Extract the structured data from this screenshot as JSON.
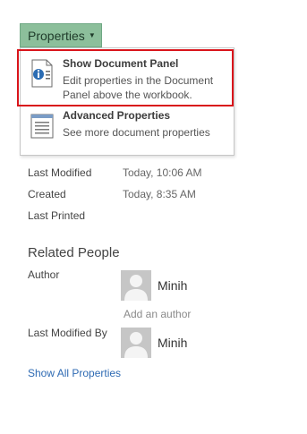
{
  "properties_button": {
    "label": "Properties",
    "caret_icon": "chevron-down-icon"
  },
  "menu": {
    "items": [
      {
        "title": "Show Document Panel",
        "description": "Edit properties in the Document Panel above the workbook.",
        "icon": "document-panel-icon"
      },
      {
        "title": "Advanced Properties",
        "description": "See more document properties",
        "icon": "advanced-properties-icon"
      }
    ],
    "highlight_color": "#d9141b"
  },
  "dates": [
    {
      "label": "Last Modified",
      "value": "Today, 10:06 AM"
    },
    {
      "label": "Created",
      "value": "Today, 8:35 AM"
    },
    {
      "label": "Last Printed",
      "value": ""
    }
  ],
  "related_people": {
    "title": "Related People",
    "author_label": "Author",
    "author_name": "Minih",
    "add_author_placeholder": "Add an author",
    "last_modified_by_label": "Last Modified By",
    "last_modified_by_name": "Minih"
  },
  "show_all_link": "Show All Properties",
  "colors": {
    "button_bg": "#8cbf9b",
    "link": "#2e6ab3"
  }
}
